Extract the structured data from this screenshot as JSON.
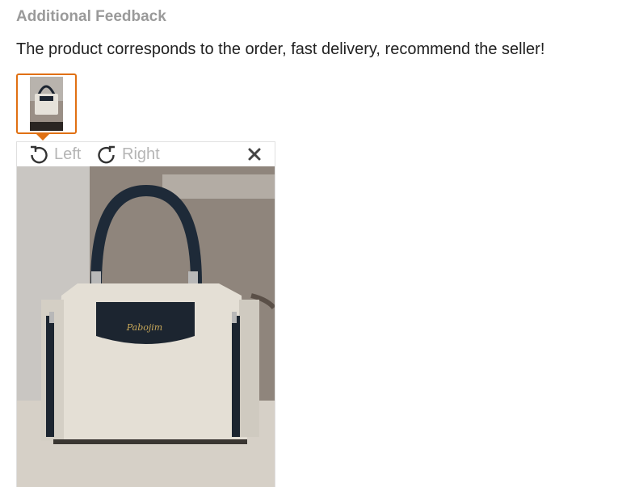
{
  "review": {
    "heading": "Additional Feedback",
    "text": "The product corresponds to the order, fast delivery, recommend the seller!"
  },
  "thumbnail": {
    "selected": true,
    "accent_color": "#e07012",
    "image_subject": "beige handbag with black handles"
  },
  "viewer": {
    "rotate_left_label": "Left",
    "rotate_right_label": "Right",
    "rotate_left_icon": "rotate-left-icon",
    "rotate_right_icon": "rotate-right-icon",
    "close_icon": "close-icon",
    "image_subject": "beige handbag with black handles",
    "handbag_logo_text": "Pabojim"
  }
}
